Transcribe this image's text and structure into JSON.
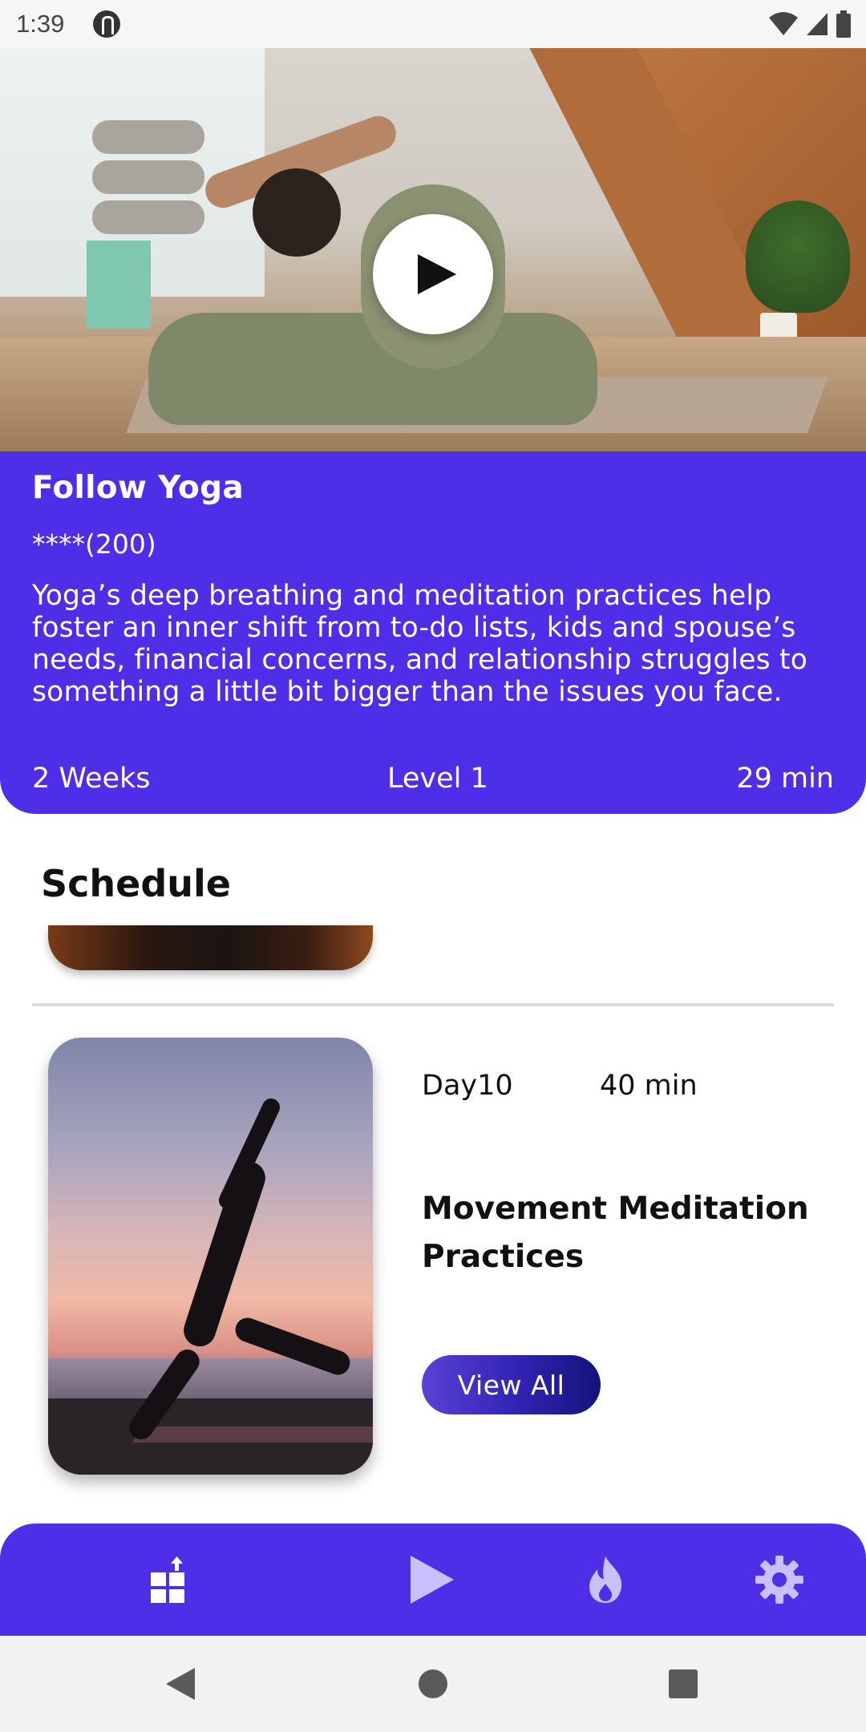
{
  "status_bar": {
    "time": "1:39"
  },
  "hero": {
    "image": "yoga-pose-photo",
    "play_icon": "play-icon"
  },
  "program": {
    "title": "Follow Yoga",
    "rating": "****(200)",
    "description": "Yoga’s deep breathing and meditation practices help foster an inner shift from to-do lists, kids and spouse’s needs, financial concerns, and relationship struggles to something a little bit bigger than the issues you face.",
    "duration_weeks": "2 Weeks",
    "level": "Level 1",
    "session_length": "29 min"
  },
  "schedule": {
    "heading": "Schedule",
    "items": [
      {
        "day": "Day10",
        "duration": "40 min",
        "title": "Movement Meditation Practices",
        "button_label": "View All",
        "image": "sunset-yoga-silhouette"
      }
    ]
  },
  "bottom_nav": {
    "items": [
      {
        "icon": "dashboard-icon"
      },
      {
        "icon": "play-icon"
      },
      {
        "icon": "fire-icon"
      },
      {
        "icon": "gear-icon"
      }
    ]
  },
  "colors": {
    "primary": "#4f2ee8",
    "button_gradient_start": "#5a42d6",
    "button_gradient_end": "#13137a",
    "nav_icon": "#ffffff",
    "nav_icon_muted": "#c8c0ff"
  }
}
